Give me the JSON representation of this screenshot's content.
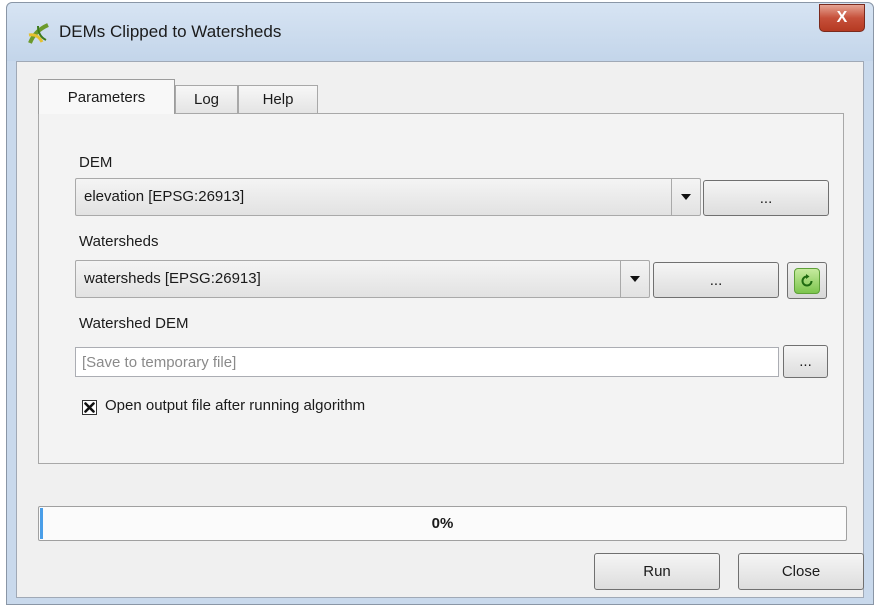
{
  "window": {
    "title": "DEMs Clipped to Watersheds",
    "close_label": "X"
  },
  "tabs": [
    {
      "label": "Parameters",
      "active": true
    },
    {
      "label": "Log",
      "active": false
    },
    {
      "label": "Help",
      "active": false
    }
  ],
  "params": {
    "dem": {
      "label": "DEM",
      "value": "elevation [EPSG:26913]",
      "browse_label": "..."
    },
    "watersheds": {
      "label": "Watersheds",
      "value": "watersheds [EPSG:26913]",
      "browse_label": "..."
    },
    "watershed_dem": {
      "label": "Watershed DEM",
      "placeholder": "[Save to temporary file]",
      "value": "",
      "browse_label": "..."
    },
    "open_output": {
      "label": "Open output file after running algorithm",
      "checked": true
    }
  },
  "progress": {
    "text": "0%",
    "value": 0
  },
  "buttons": {
    "run": "Run",
    "close": "Close"
  },
  "icons": {
    "app": "qgis-icon",
    "reload": "reload-icon",
    "dropdown": "chevron-down-icon",
    "check": "checkmark-icon"
  },
  "colors": {
    "progress_fill": "#4a9ee8",
    "close_button": "#c6503a",
    "reload_button": "#7cc54d"
  }
}
